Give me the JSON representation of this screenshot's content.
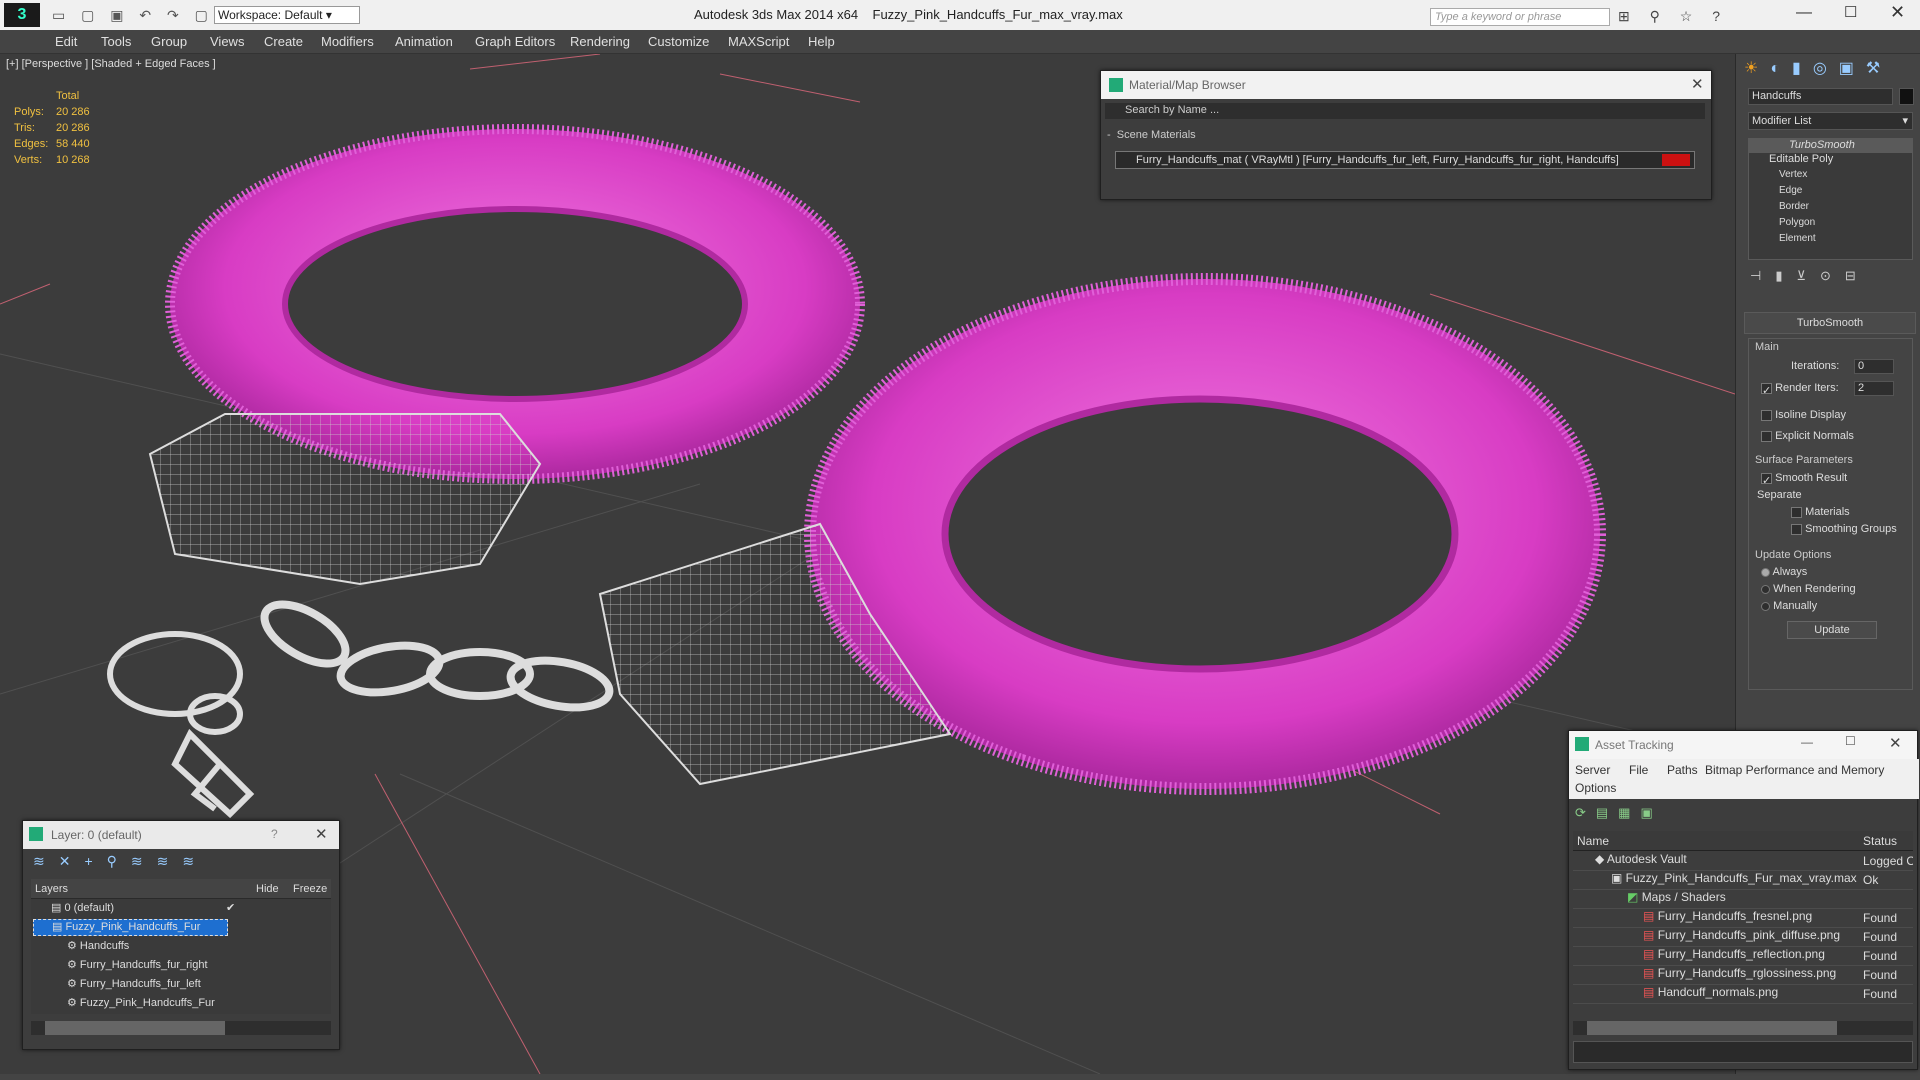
{
  "app": {
    "title": "Autodesk 3ds Max  2014 x64",
    "file": "Fuzzy_Pink_Handcuffs_Fur_max_vray.max",
    "workspace": "Workspace: Default",
    "search_placeholder": "Type a keyword or phrase"
  },
  "menu": [
    "Edit",
    "Tools",
    "Group",
    "Views",
    "Create",
    "Modifiers",
    "Animation",
    "Graph Editors",
    "Rendering",
    "Customize",
    "MAXScript",
    "Help"
  ],
  "viewport": {
    "label": "[+] [Perspective ] [Shaded + Edged Faces ]",
    "stats": {
      "total_label": "Total",
      "rows": [
        {
          "k": "Polys:",
          "v": "20 286"
        },
        {
          "k": "Tris:",
          "v": "20 286"
        },
        {
          "k": "Edges:",
          "v": "58 440"
        },
        {
          "k": "Verts:",
          "v": "10 268"
        }
      ]
    }
  },
  "material_browser": {
    "title": "Material/Map Browser",
    "search_placeholder": "Search by Name ...",
    "section": "Scene Materials",
    "item": "Furry_Handcuffs_mat  ( VRayMtl ) [Furry_Handcuffs_fur_left, Furry_Handcuffs_fur_right, Handcuffs]",
    "swatch": "#cc1111"
  },
  "command_panel": {
    "object_name": "Handcuffs",
    "modifier_list": "Modifier List",
    "stack": [
      "TurboSmooth",
      "Editable Poly",
      "Vertex",
      "Edge",
      "Border",
      "Polygon",
      "Element"
    ],
    "turbosmooth": {
      "title": "TurboSmooth",
      "main": "Main",
      "iterations_label": "Iterations:",
      "iterations": "0",
      "render_iters_label": "Render Iters:",
      "render_iters": "2",
      "isoline": "Isoline Display",
      "explicit": "Explicit Normals",
      "surface_params": "Surface Parameters",
      "smooth_result": "Smooth Result",
      "separate": "Separate",
      "materials": "Materials",
      "smoothing_groups": "Smoothing Groups",
      "update_options": "Update Options",
      "always": "Always",
      "when_rendering": "When Rendering",
      "manually": "Manually",
      "update_button": "Update"
    }
  },
  "layer_window": {
    "title": "Layer: 0 (default)",
    "help": "?",
    "col_layers": "Layers",
    "col_hide": "Hide",
    "col_freeze": "Freeze",
    "rows": [
      "0 (default)",
      "Fuzzy_Pink_Handcuffs_Fur",
      "Handcuffs",
      "Furry_Handcuffs_fur_right",
      "Furry_Handcuffs_fur_left",
      "Fuzzy_Pink_Handcuffs_Fur"
    ]
  },
  "asset_tracking": {
    "title": "Asset Tracking",
    "menu": [
      "Server",
      "File",
      "Paths",
      "Bitmap Performance and Memory",
      "Options"
    ],
    "col_name": "Name",
    "col_status": "Status",
    "rows": [
      {
        "name": "Autodesk Vault",
        "status": "Logged O"
      },
      {
        "name": "Fuzzy_Pink_Handcuffs_Fur_max_vray.max",
        "status": "Ok"
      },
      {
        "name": "Maps / Shaders",
        "status": ""
      },
      {
        "name": "Furry_Handcuffs_fresnel.png",
        "status": "Found"
      },
      {
        "name": "Furry_Handcuffs_pink_diffuse.png",
        "status": "Found"
      },
      {
        "name": "Furry_Handcuffs_reflection.png",
        "status": "Found"
      },
      {
        "name": "Furry_Handcuffs_rglossiness.png",
        "status": "Found"
      },
      {
        "name": "Handcuff_normals.png",
        "status": "Found"
      }
    ]
  },
  "colors": {
    "fur": "#e040c8",
    "viewport_bg": "#3c3c3c",
    "accent": "#f0c040"
  }
}
